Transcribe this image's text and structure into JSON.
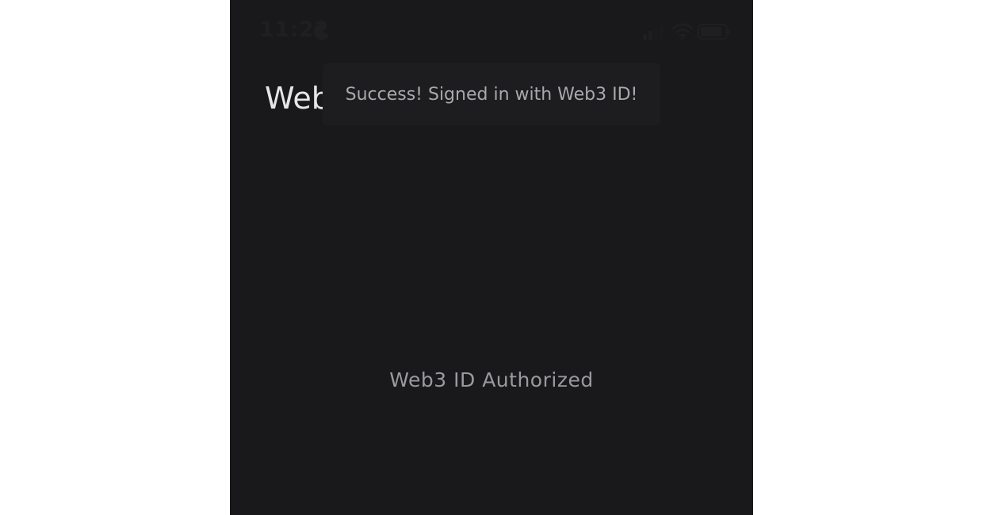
{
  "status_bar": {
    "time": "11:22",
    "icons": [
      "moon-icon",
      "cellular-signal-icon",
      "wifi-icon",
      "battery-icon"
    ]
  },
  "header": {
    "title": "Web"
  },
  "toast": {
    "message": "Success! Signed in with Web3 ID!"
  },
  "main": {
    "status_text": "Web3 ID Authorized"
  },
  "colors": {
    "background": "#19191b",
    "toast_background": "#1d1d20",
    "text_primary": "#e6e6e6",
    "text_secondary": "#9a9a9e"
  }
}
